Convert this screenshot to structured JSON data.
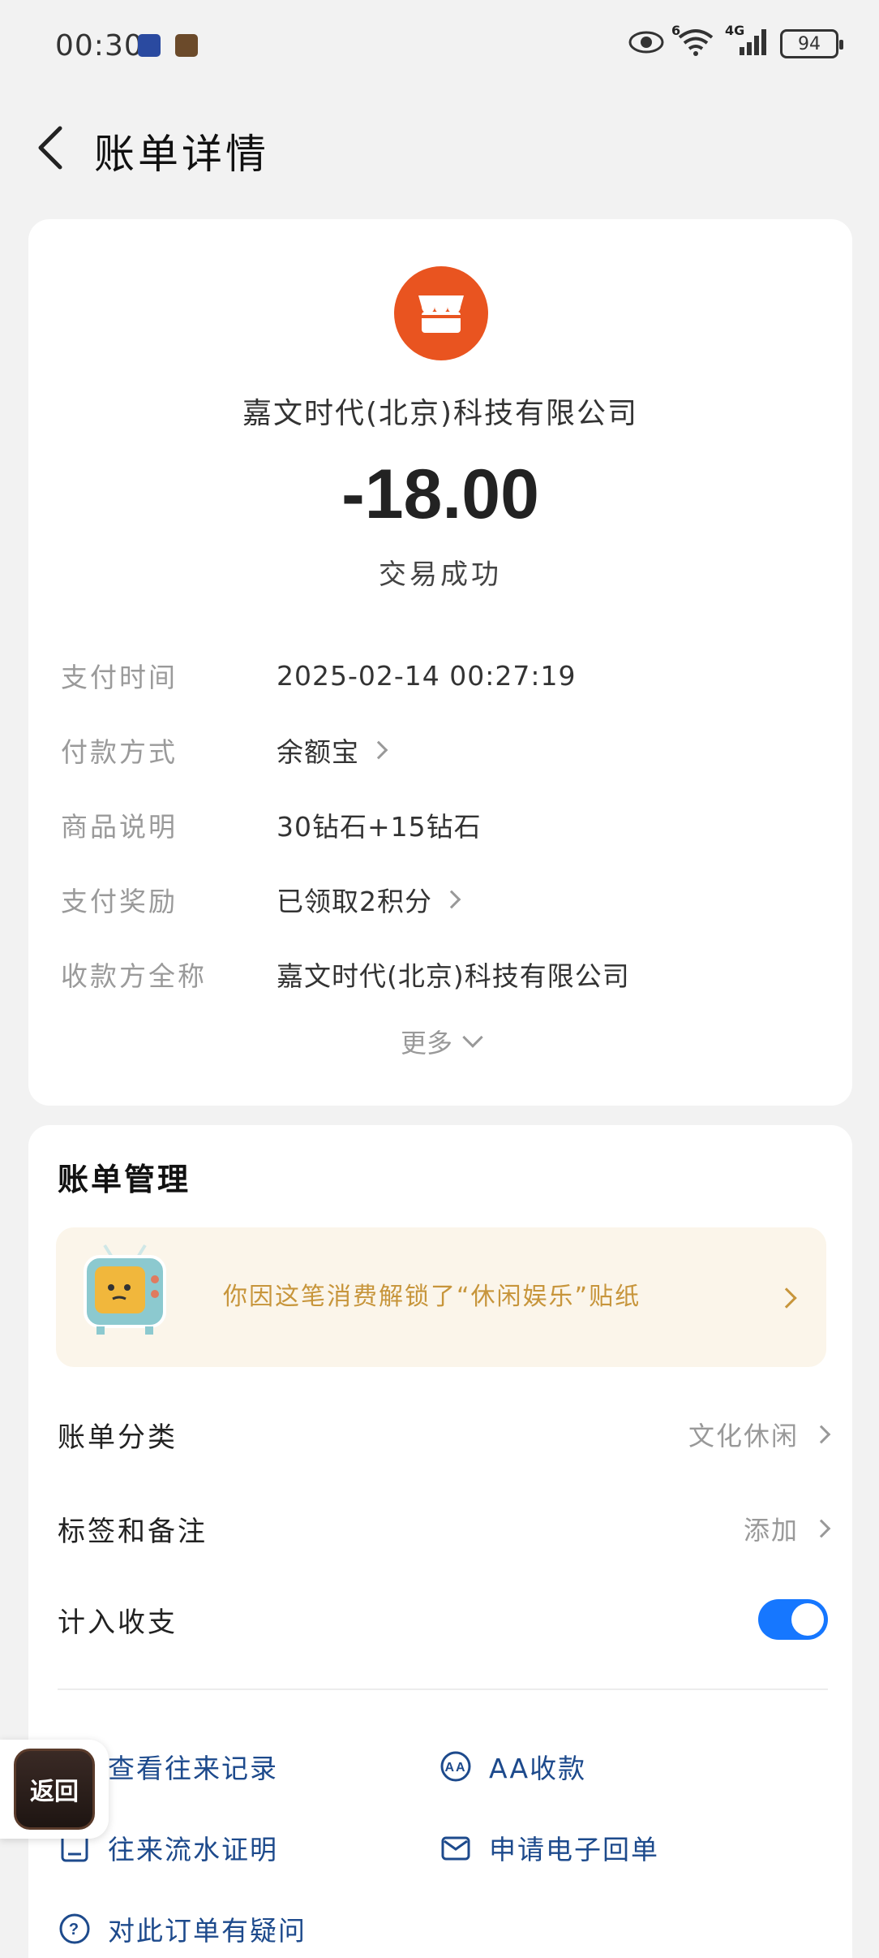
{
  "status_bar": {
    "time": "00:30",
    "signal_label": "4G",
    "wifi_label": "6",
    "battery": "94"
  },
  "header": {
    "title": "账单详情"
  },
  "transaction": {
    "merchant_name": "嘉文时代(北京)科技有限公司",
    "amount": "-18.00",
    "status": "交易成功",
    "details": [
      {
        "label": "支付时间",
        "value": "2025-02-14 00:27:19",
        "has_chevron": false
      },
      {
        "label": "付款方式",
        "value": "余额宝",
        "has_chevron": true
      },
      {
        "label": "商品说明",
        "value": "30钻石+15钻石",
        "has_chevron": false
      },
      {
        "label": "支付奖励",
        "value": "已领取2积分",
        "has_chevron": true
      },
      {
        "label": "收款方全称",
        "value": "嘉文时代(北京)科技有限公司",
        "has_chevron": false
      }
    ],
    "more_label": "更多"
  },
  "management": {
    "title": "账单管理",
    "banner_text": "你因这笔消费解锁了“休闲娱乐”贴纸",
    "category": {
      "label": "账单分类",
      "value": "文化休闲"
    },
    "tags": {
      "label": "标签和备注",
      "value": "添加"
    },
    "count_in": {
      "label": "计入收支",
      "enabled": true
    },
    "links": [
      {
        "label": "查看往来记录",
        "icon": "records-icon"
      },
      {
        "label": "AA收款",
        "icon": "aa-icon"
      },
      {
        "label": "往来流水证明",
        "icon": "certificate-icon"
      },
      {
        "label": "申请电子回单",
        "icon": "mail-icon"
      },
      {
        "label": "对此订单有疑问",
        "icon": "question-icon"
      }
    ]
  },
  "float_button": {
    "label": "返回"
  },
  "colors": {
    "brand_blue": "#1677ff",
    "merchant_orange": "#e95420",
    "banner_gold": "#c7953b",
    "link_blue": "#1d4a8c"
  }
}
